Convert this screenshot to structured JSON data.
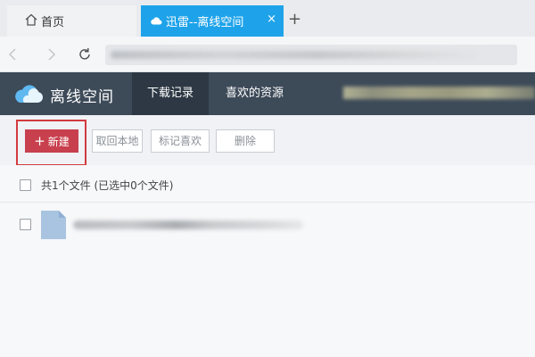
{
  "browser": {
    "tabs": [
      {
        "label": "首页",
        "icon": "home-icon",
        "active": false
      },
      {
        "label": "迅雷--离线空间",
        "icon": "cloud-icon",
        "active": true
      }
    ],
    "close_symbol": "×",
    "new_tab_symbol": "+",
    "active_tab_color": "#1ea3ea"
  },
  "app": {
    "name": "离线空间",
    "nav": {
      "downloads": "下载记录",
      "favorites": "喜欢的资源"
    },
    "header_color": "#3d4a58"
  },
  "toolbar": {
    "new_plus": "+",
    "new_label": "新建",
    "fetch_label": "取回本地",
    "mark_label": "标记喜欢",
    "delete_label": "删除",
    "new_button_color": "#c8404d",
    "highlight_color": "#d23a3f"
  },
  "file_list": {
    "summary": "共1个文件 (已选中0个文件)",
    "files": [
      {
        "icon": "file-icon",
        "name_blurred": true
      }
    ]
  }
}
